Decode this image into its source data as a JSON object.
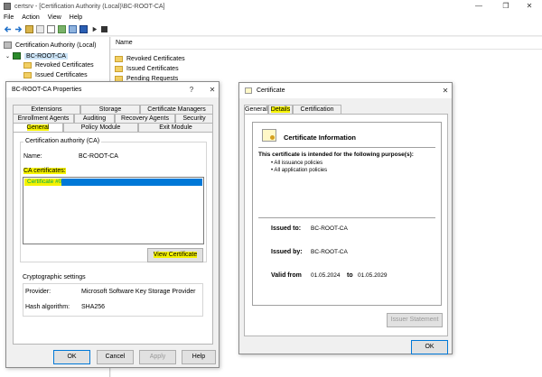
{
  "window": {
    "title": "certsrv - [Certification Authority (Local)\\BC-ROOT-CA]",
    "controls": [
      "—",
      "❐",
      "✕"
    ]
  },
  "menu": [
    "File",
    "Action",
    "View",
    "Help"
  ],
  "tree": {
    "root": "Certification Authority (Local)",
    "ca": "BC-ROOT-CA",
    "items": [
      "Revoked Certificates",
      "Issued Certificates"
    ]
  },
  "list": {
    "header": "Name",
    "items": [
      "Revoked Certificates",
      "Issued Certificates",
      "Pending Requests"
    ]
  },
  "props": {
    "title": "BC-ROOT-CA Properties",
    "help": "?",
    "close": "✕",
    "tabs_row1": [
      "Extensions",
      "Storage",
      "Certificate Managers"
    ],
    "tabs_row2": [
      "Enrollment Agents",
      "Auditing",
      "Recovery Agents",
      "Security"
    ],
    "tabs_row3": [
      "General",
      "Policy Module",
      "Exit Module"
    ],
    "ca_group": "Certification authority (CA)",
    "name_label": "Name:",
    "name_value": "BC-ROOT-CA",
    "certs_label": "CA certificates:",
    "cert_item": "Certificate #0",
    "view_cert": "View Certificate",
    "crypto_group": "Cryptographic settings",
    "provider_label": "Provider:",
    "provider_value": "Microsoft Software Key Storage Provider",
    "hash_label": "Hash algorithm:",
    "hash_value": "SHA256",
    "ok": "OK",
    "cancel": "Cancel",
    "apply": "Apply",
    "helpbtn": "Help"
  },
  "cert": {
    "title": "Certificate",
    "close": "✕",
    "tabs": [
      "General",
      "Details",
      "Certification Path"
    ],
    "info_title": "Certificate Information",
    "purpose_heading": "This certificate is intended for the following purpose(s):",
    "purposes": [
      "• All issuance policies",
      "• All application policies"
    ],
    "issued_to_label": "Issued to:",
    "issued_to_value": "BC-ROOT-CA",
    "issued_by_label": "Issued by:",
    "issued_by_value": "BC-ROOT-CA",
    "valid_from_label": "Valid from",
    "valid_from_value": "01.05.2024",
    "valid_to_label": "to",
    "valid_to_value": "01.05.2029",
    "issuer_statement": "Issuer Statement",
    "ok": "OK"
  }
}
